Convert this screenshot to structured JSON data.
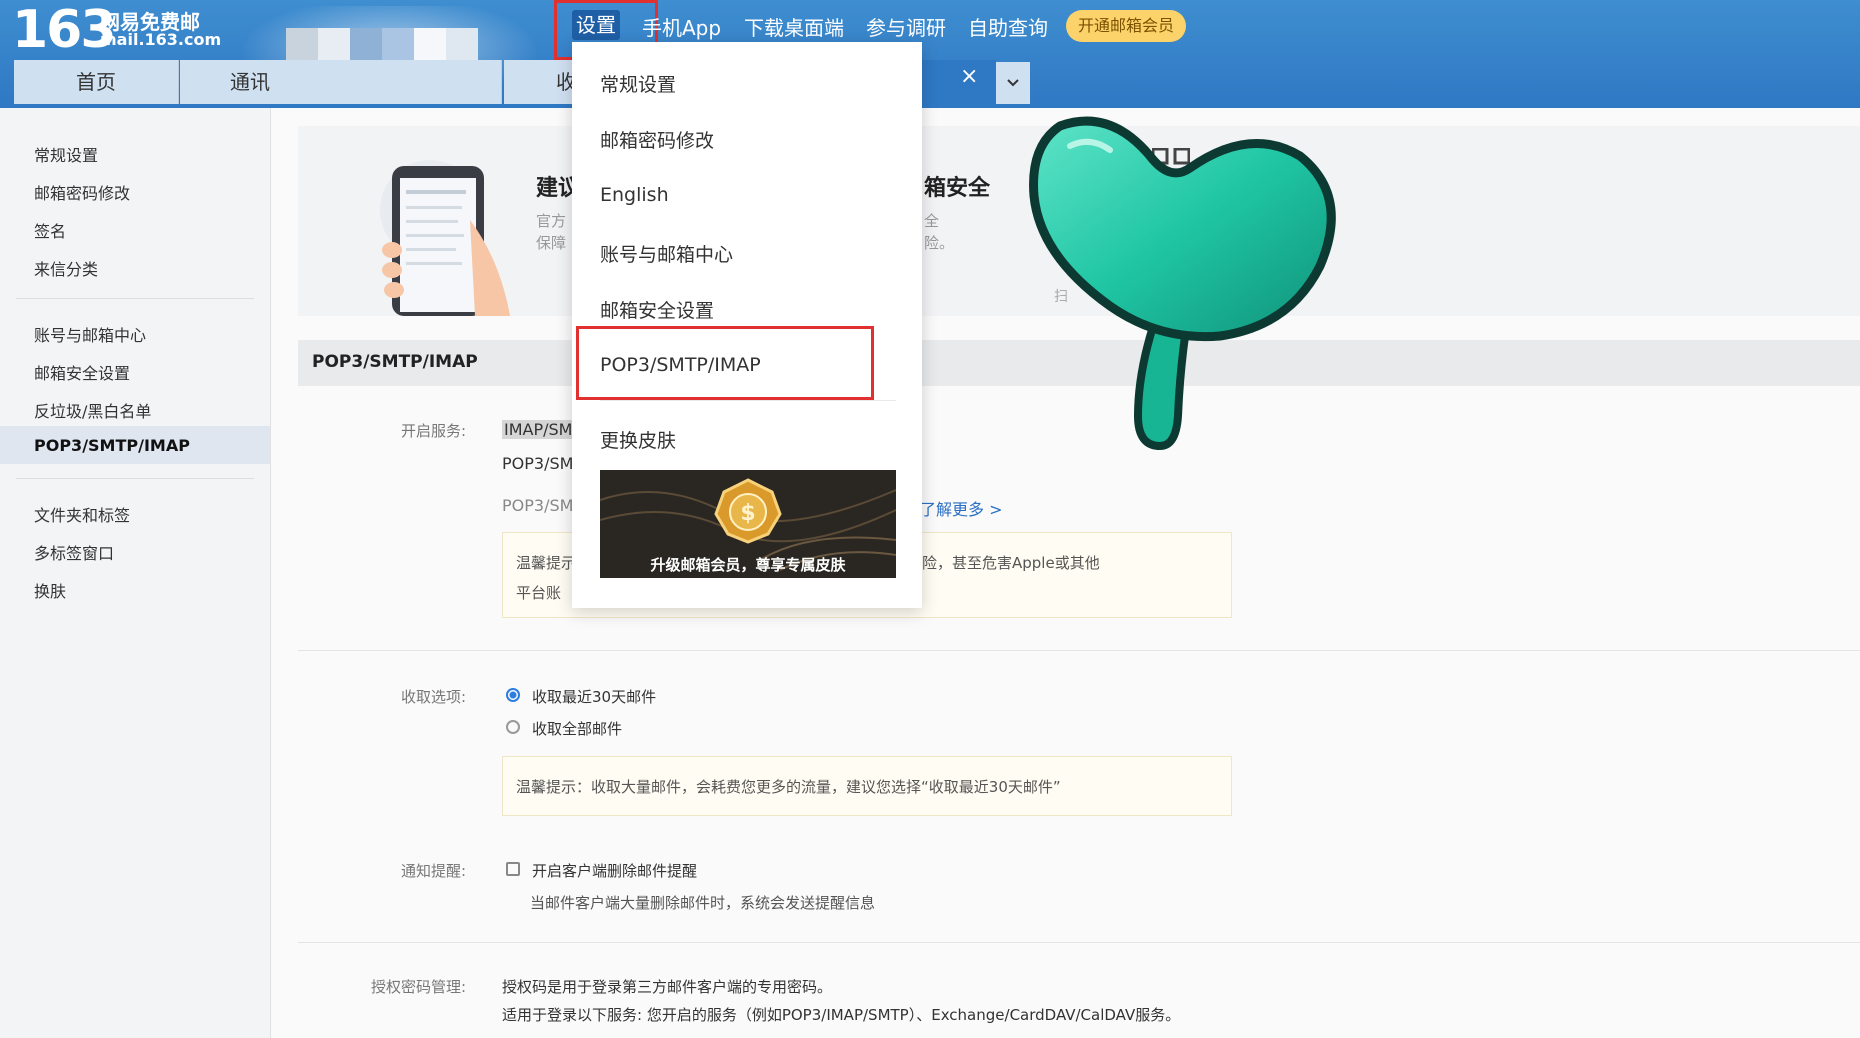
{
  "header": {
    "logo_number": "163",
    "logo_name": "网易免费邮",
    "logo_domain": "mail.163.com",
    "nav": [
      "设置",
      "手机App",
      "下载桌面端",
      "参与调研",
      "自助查询"
    ],
    "vip_button": "开通邮箱会员"
  },
  "tabs": [
    "首页",
    "通讯",
    "收"
  ],
  "tab_close": "×",
  "dropdown": {
    "items": [
      "常规设置",
      "邮箱密码修改",
      "English",
      "账号与邮箱中心",
      "邮箱安全设置",
      "POP3/SMTP/IMAP",
      "更换皮肤"
    ],
    "promo_text": "升级邮箱会员，尊享专属皮肤"
  },
  "sidebar": {
    "group1": [
      "常规设置",
      "邮箱密码修改",
      "签名",
      "来信分类"
    ],
    "group2": [
      "账号与邮箱中心",
      "邮箱安全设置",
      "反垃圾/黑白名单",
      "POP3/SMTP/IMAP"
    ],
    "group3": [
      "文件夹和标签",
      "多标签窗口",
      "换肤"
    ]
  },
  "banner": {
    "title_left": "建议",
    "title_right": "箱安全",
    "desc_left": [
      "官方",
      "保障"
    ],
    "desc_right": [
      "全",
      "险。"
    ],
    "scan_hint": "扫"
  },
  "section": {
    "title": "POP3/SMTP/IMAP",
    "service": {
      "label": "开启服务:",
      "line1": "IMAP/SM",
      "line2": "POP3/SM",
      "line3": "POP3/SM",
      "learn_more": "了解更多 >",
      "tip_left": [
        "温馨提示",
        "平台账"
      ],
      "tip_right": "险，甚至危害Apple或其他"
    },
    "receive": {
      "label": "收取选项:",
      "options": [
        "收取最近30天邮件",
        "收取全部邮件"
      ],
      "selected": 0,
      "tip": "温馨提示：收取大量邮件，会耗费您更多的流量，建议您选择“收取最近30天邮件”"
    },
    "notify": {
      "label": "通知提醒:",
      "checkbox": "开启客户端删除邮件提醒",
      "note": "当邮件客户端大量删除邮件时，系统会发送提醒信息"
    },
    "auth": {
      "label": "授权密码管理:",
      "line1": "授权码是用于登录第三方邮件客户端的专用密码。",
      "line2": "适用于登录以下服务: 您开启的服务（例如POP3/IMAP/SMTP）、Exchange/CardDAV/CalDAV服务。"
    }
  },
  "colors": {
    "header_blue": "#2f78c4",
    "highlight_red": "#e03030",
    "vip_gold": "#fbd36a",
    "sprout_green": "#1fc6a4"
  }
}
